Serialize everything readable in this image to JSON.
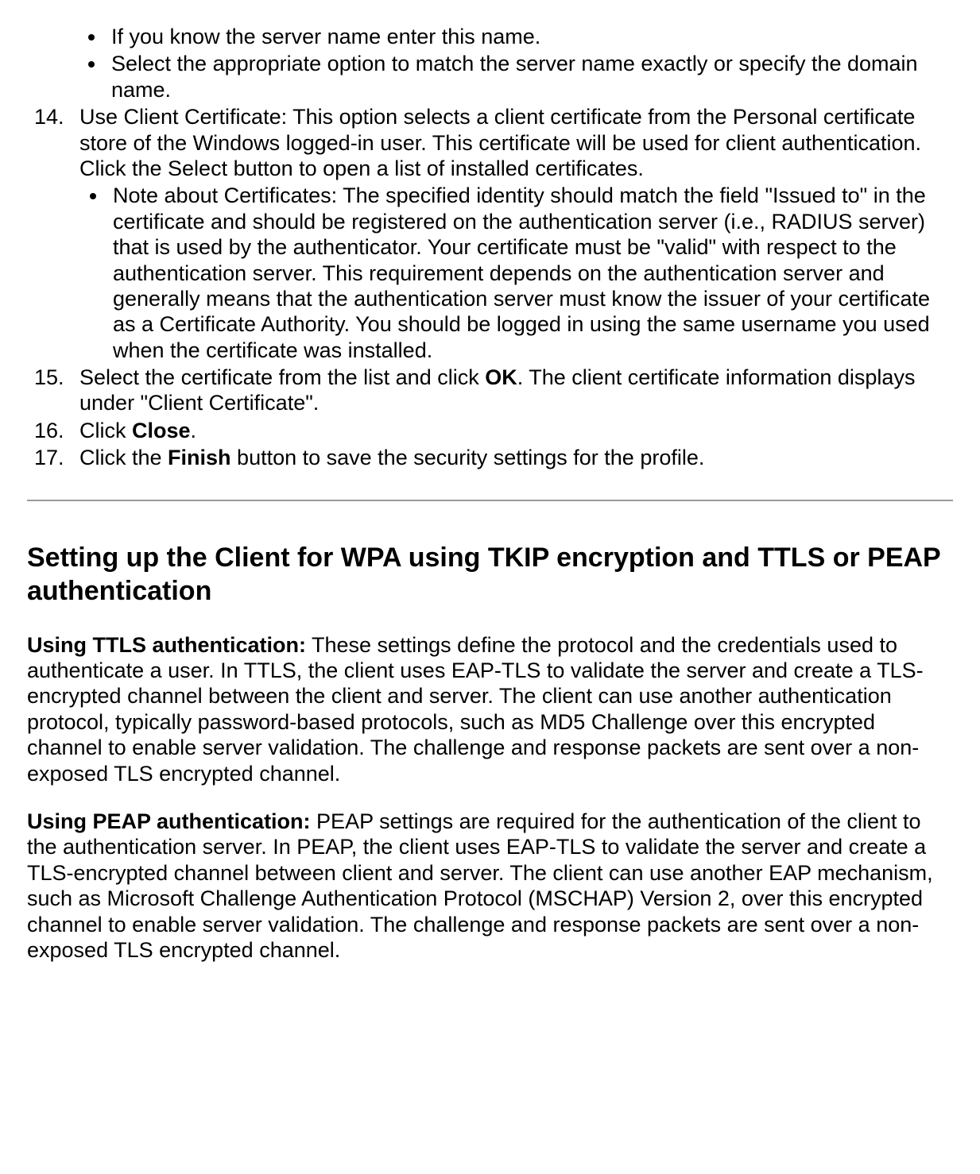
{
  "pre_bullets": [
    "If you know the server name enter this name.",
    "Select the appropriate option to match the server name exactly or specify the domain name."
  ],
  "steps": [
    {
      "text_before": "Use Client Certificate: This option selects a client certificate from the Personal certificate store of the Windows logged-in user. This certificate will be used for client authentication. Click the Select button to open a list of installed certificates.",
      "subs": [
        "Note about Certificates: The specified identity should match the field \"Issued to\" in the certificate and should be registered on the authentication server (i.e., RADIUS server) that is used by the authenticator. Your certificate must be \"valid\" with respect to the authentication server. This requirement depends on the authentication server and generally means that the authentication server must know the issuer of your certificate as a Certificate Authority. You should be logged in using the same username you used when the certificate was installed."
      ]
    },
    {
      "text_before": "Select the certificate from the list and click ",
      "bold": "OK",
      "text_after": ". The client certificate information displays under \"Client Certificate\"."
    },
    {
      "text_before": "Click ",
      "bold": "Close",
      "text_after": "."
    },
    {
      "text_before": "Click the ",
      "bold": "Finish",
      "text_after": " button to save the security settings for the profile."
    }
  ],
  "heading": "Setting up the Client for WPA using TKIP encryption and TTLS or PEAP authentication",
  "para1": {
    "bold": "Using TTLS authentication:",
    "rest": " These settings define the protocol and the credentials used to authenticate a user. In TTLS, the client uses EAP-TLS to validate the server and create a TLS-encrypted channel between the client and server. The client can use another authentication protocol, typically password-based protocols, such as MD5 Challenge over this encrypted channel to enable server validation. The challenge and response packets are sent over a non-exposed TLS encrypted channel."
  },
  "para2": {
    "bold": "Using PEAP authentication:",
    "rest": " PEAP settings are required for the authentication of the client to the authentication server. In PEAP, the client uses EAP-TLS to validate the server and create a TLS-encrypted channel between client and server. The client can use another EAP mechanism, such as Microsoft Challenge Authentication Protocol (MSCHAP) Version 2, over this encrypted channel to enable server validation. The challenge and response packets are sent over a non-exposed TLS encrypted channel."
  }
}
